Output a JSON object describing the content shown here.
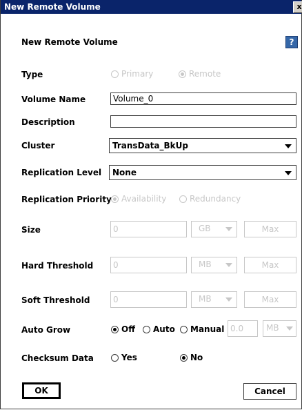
{
  "window": {
    "title": "New Remote Volume",
    "close_glyph": "x"
  },
  "header": {
    "title": "New Remote Volume",
    "help_glyph": "?"
  },
  "labels": {
    "type": "Type",
    "volume_name": "Volume Name",
    "description": "Description",
    "cluster": "Cluster",
    "replication_level": "Replication Level",
    "replication_priority": "Replication Priority",
    "size": "Size",
    "hard_threshold": "Hard Threshold",
    "soft_threshold": "Soft Threshold",
    "auto_grow": "Auto Grow",
    "checksum_data": "Checksum Data"
  },
  "type_options": {
    "primary": "Primary",
    "remote": "Remote",
    "selected": "remote"
  },
  "fields": {
    "volume_name": "Volume_0",
    "description": "",
    "cluster": "TransData_BkUp",
    "replication_level": "None",
    "size_value": "0",
    "size_unit": "GB",
    "hard_threshold_value": "0",
    "hard_threshold_unit": "MB",
    "soft_threshold_value": "0",
    "soft_threshold_unit": "MB",
    "auto_grow_value": "0.0",
    "auto_grow_unit": "MB"
  },
  "replication_priority_options": {
    "availability": "Availability",
    "redundancy": "Redundancy",
    "selected": "availability"
  },
  "auto_grow_options": {
    "off": "Off",
    "auto": "Auto",
    "manual": "Manual",
    "selected": "off"
  },
  "checksum_options": {
    "yes": "Yes",
    "no": "No",
    "selected": "no"
  },
  "buttons": {
    "max": "Max",
    "ok": "OK",
    "cancel": "Cancel"
  }
}
